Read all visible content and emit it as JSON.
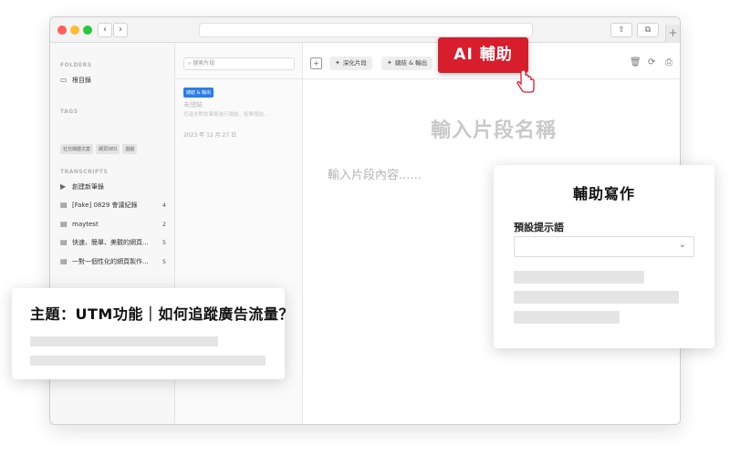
{
  "sidebar": {
    "folders_label": "FOLDERS",
    "root_folder": "根目錄",
    "tags_label": "TAGS",
    "tags": [
      "社交媒體文案",
      "網頁SEO",
      "遊戲"
    ],
    "transcripts_label": "TRANSCRIPTS",
    "new_note": "創建新筆錄",
    "items": [
      {
        "label": "[Fake] 0829 會議紀錄",
        "count": "4"
      },
      {
        "label": "maytest",
        "count": "2"
      },
      {
        "label": "快速、簡單、美觀的網頁...",
        "count": "5"
      },
      {
        "label": "一對一個性化的網頁製作...",
        "count": "5"
      }
    ]
  },
  "notelist": {
    "search_placeholder": "搜索片段",
    "badge": "總結 & 輸出",
    "note_title": "未總結",
    "note_sub": "您還未對該筆錄進行總結，點擊總結...",
    "note_date": "2023 年 12 月 27 日"
  },
  "toolbar": {
    "deepen_label": "深化片段",
    "summarize_label": "總結 & 輸出"
  },
  "editor": {
    "title_placeholder": "輸入片段名稱",
    "body_placeholder": "輸入片段內容......"
  },
  "ai_button": {
    "label": "AI 輔助"
  },
  "card_left": {
    "title": "主題：UTM功能｜如何追蹤廣告流量？"
  },
  "card_right": {
    "title": "輔助寫作",
    "prompt_label": "預設提示語"
  },
  "colors": {
    "accent_red": "#d81e2c",
    "badge_blue": "#2b7de9"
  }
}
